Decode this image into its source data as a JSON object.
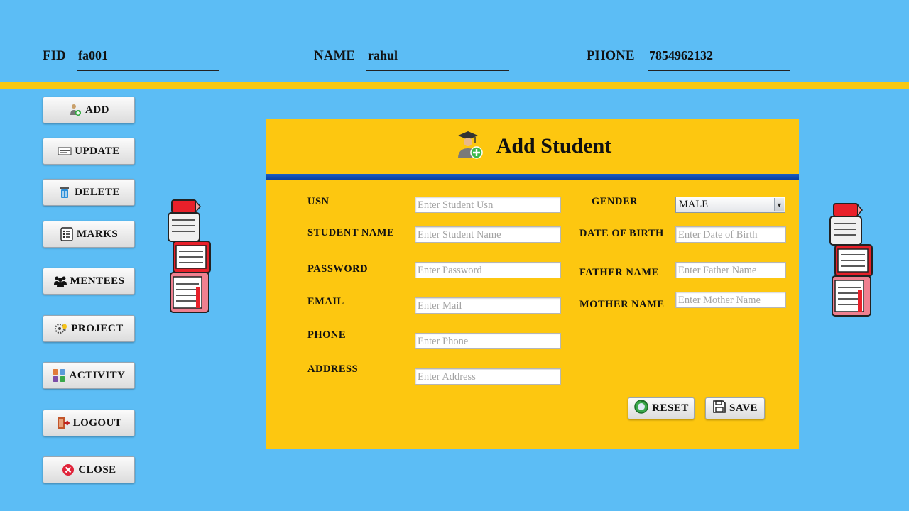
{
  "header": {
    "fid_label": "FID",
    "fid_value": "fa001",
    "name_label": "NAME",
    "name_value": "rahul",
    "phone_label": "PHONE",
    "phone_value": "7854962132"
  },
  "sidebar": {
    "items": [
      {
        "label": "ADD",
        "icon": "add-user-icon"
      },
      {
        "label": "UPDATE",
        "icon": "update-icon"
      },
      {
        "label": "DELETE",
        "icon": "trash-icon"
      },
      {
        "label": "MARKS",
        "icon": "list-icon"
      },
      {
        "label": "MENTEES",
        "icon": "group-icon"
      },
      {
        "label": "PROJECT",
        "icon": "gear-bulb-icon"
      },
      {
        "label": "ACTIVITY",
        "icon": "activity-icon"
      },
      {
        "label": "LOGOUT",
        "icon": "exit-door-icon"
      },
      {
        "label": "CLOSE",
        "icon": "close-icon"
      }
    ]
  },
  "form": {
    "title": "Add Student",
    "fields": {
      "usn": {
        "label": "USN",
        "placeholder": "Enter Student Usn"
      },
      "student_name": {
        "label": "STUDENT NAME",
        "placeholder": "Enter Student Name"
      },
      "password": {
        "label": "PASSWORD",
        "placeholder": "Enter Password"
      },
      "email": {
        "label": "EMAIL",
        "placeholder": "Enter Mail"
      },
      "phone": {
        "label": "PHONE",
        "placeholder": "Enter Phone"
      },
      "address": {
        "label": "ADDRESS",
        "placeholder": "Enter Address"
      },
      "gender": {
        "label": "GENDER",
        "value": "MALE"
      },
      "dob": {
        "label": "DATE OF BIRTH",
        "placeholder": "Enter Date of Birth"
      },
      "father_name": {
        "label": "FATHER NAME",
        "placeholder": "Enter Father Name"
      },
      "mother_name": {
        "label": "MOTHER NAME",
        "placeholder": "Enter Mother Name"
      }
    },
    "reset_label": "RESET",
    "save_label": "SAVE"
  },
  "colors": {
    "background": "#5cbdf5",
    "panel": "#fdc710",
    "accent_bar": "#0a3fa0",
    "strip": "#f8c812"
  }
}
